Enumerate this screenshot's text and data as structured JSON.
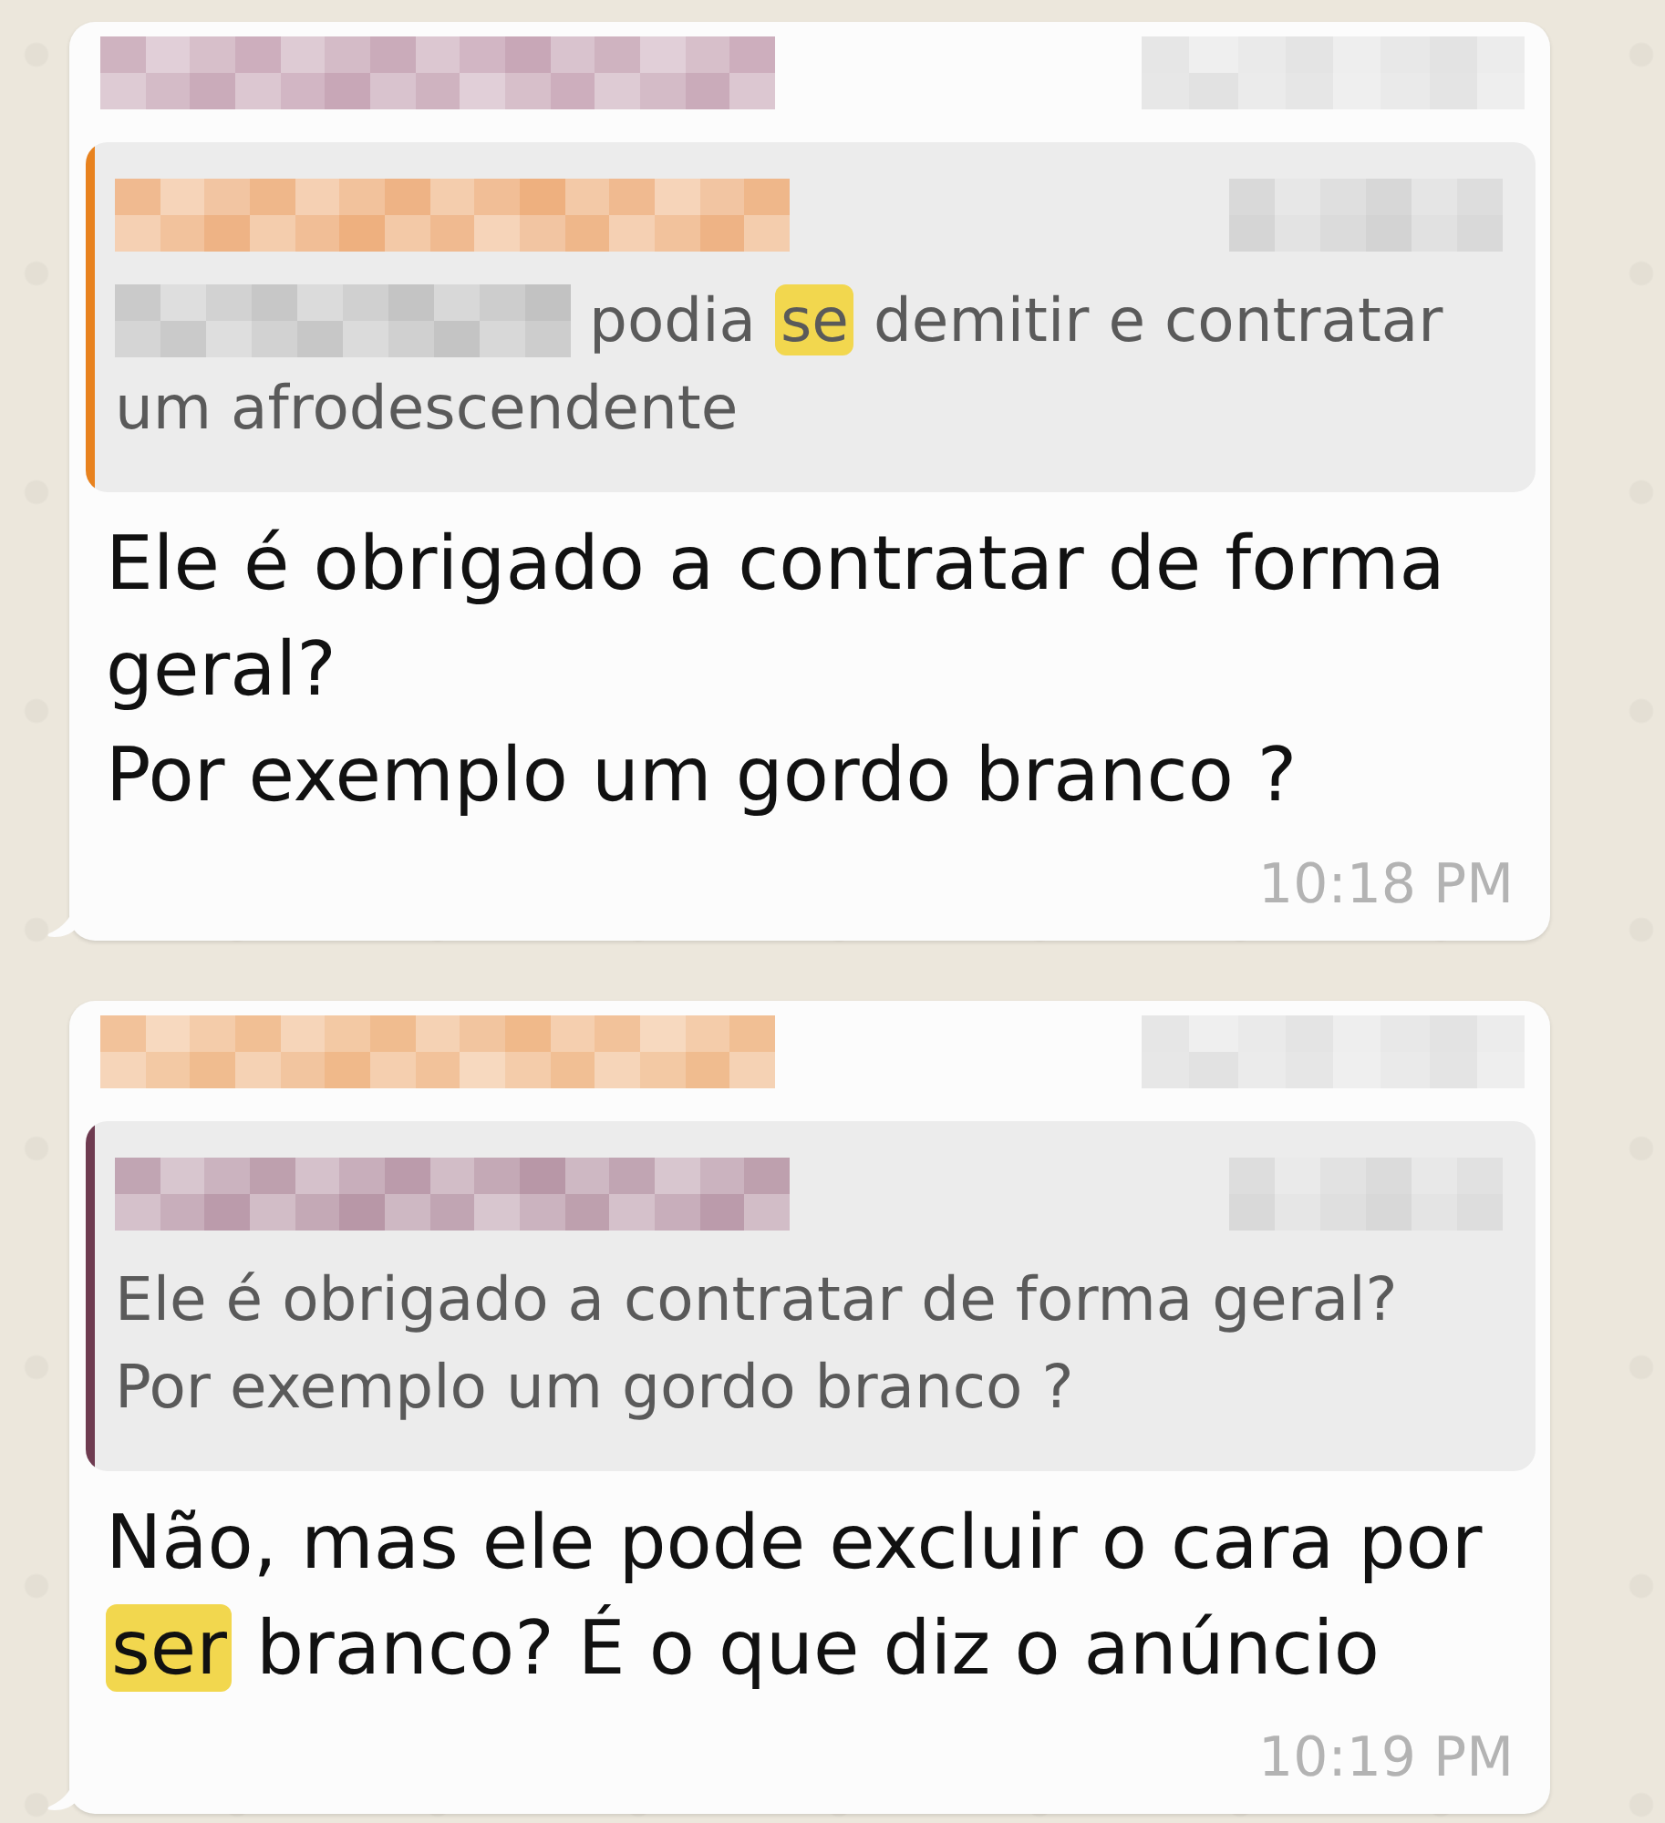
{
  "messages": [
    {
      "sender": {
        "color": "#c8a7b7"
      },
      "sender_detail": {
        "color": "#e2e2e2"
      },
      "quote": {
        "color": "#e8821e",
        "sender": {
          "color": "#eeb07f"
        },
        "sender_detail": {
          "color": "#d3d3d3"
        },
        "redacted_prefix": {
          "color": "#c2c2c2"
        },
        "segments": [
          {
            "text": "podia ",
            "highlighted": false
          },
          {
            "text": "se",
            "highlighted": true
          },
          {
            "text": " demitir e contratar um afrodescendente",
            "highlighted": false
          }
        ]
      },
      "segments": [
        {
          "text": "Ele é obrigado a contratar de forma geral?\nPor exemplo um gordo branco ?",
          "highlighted": false
        }
      ],
      "time": "10:18 PM"
    },
    {
      "sender": {
        "color": "#f0b98a"
      },
      "sender_detail": {
        "color": "#e2e2e2"
      },
      "quote": {
        "color": "#6e3b50",
        "sender": {
          "color": "#b897a7"
        },
        "sender_detail": {
          "color": "#d8d8d8"
        },
        "segments": [
          {
            "text": "Ele é obrigado a contratar de forma geral?\nPor exemplo um gordo branco ?",
            "highlighted": false
          }
        ]
      },
      "segments": [
        {
          "text": "Não, mas ele pode excluir o cara por ",
          "highlighted": false
        },
        {
          "text": "ser",
          "highlighted": true
        },
        {
          "text": " branco? É o que diz o anúncio",
          "highlighted": false
        }
      ],
      "time": "10:19 PM"
    }
  ]
}
